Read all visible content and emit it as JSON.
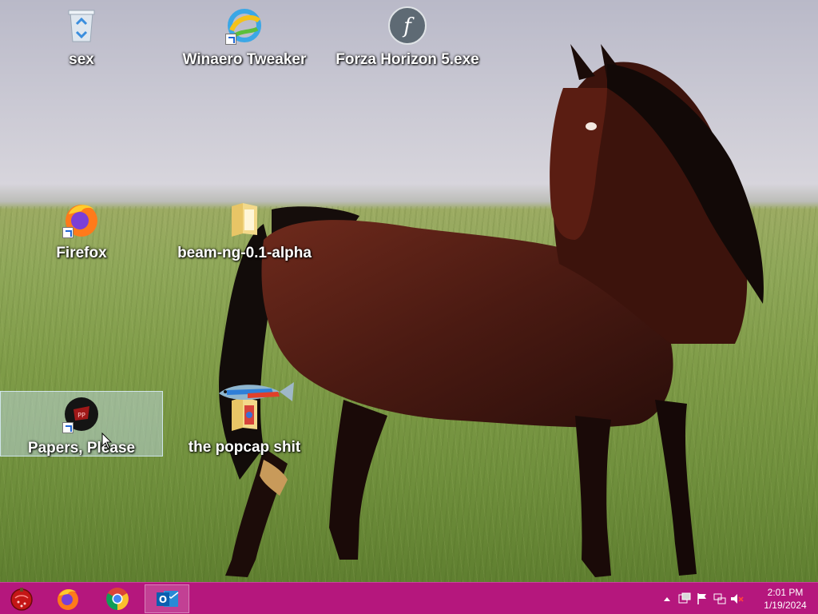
{
  "desktop": {
    "icons": [
      {
        "label": "sex",
        "icon": "recycle-bin-icon"
      },
      {
        "label": "Winaero Tweaker",
        "icon": "winaero-icon"
      },
      {
        "label": "Forza Horizon 5.exe",
        "icon": "flash-icon"
      },
      {
        "label": "Firefox",
        "icon": "firefox-icon"
      },
      {
        "label": "beam-ng-0.1-alpha",
        "icon": "folder-icon"
      },
      {
        "label": "Papers, Please",
        "icon": "papers-please-icon",
        "selected": true
      },
      {
        "label": "the popcap shit",
        "icon": "folder-icon"
      }
    ]
  },
  "taskbar": {
    "color": "#b5177d",
    "pinned": [
      {
        "name": "start-orb",
        "icon": "start-orb-icon"
      },
      {
        "name": "firefox",
        "icon": "firefox-icon"
      },
      {
        "name": "chrome",
        "icon": "chrome-icon"
      },
      {
        "name": "outlook",
        "icon": "outlook-icon",
        "active": true
      }
    ],
    "tray": {
      "icons": [
        "show-hidden-icon",
        "action-center-icon",
        "flag-icon",
        "network-icon",
        "volume-muted-icon"
      ],
      "time": "2:01 PM",
      "date": "1/19/2024"
    }
  }
}
